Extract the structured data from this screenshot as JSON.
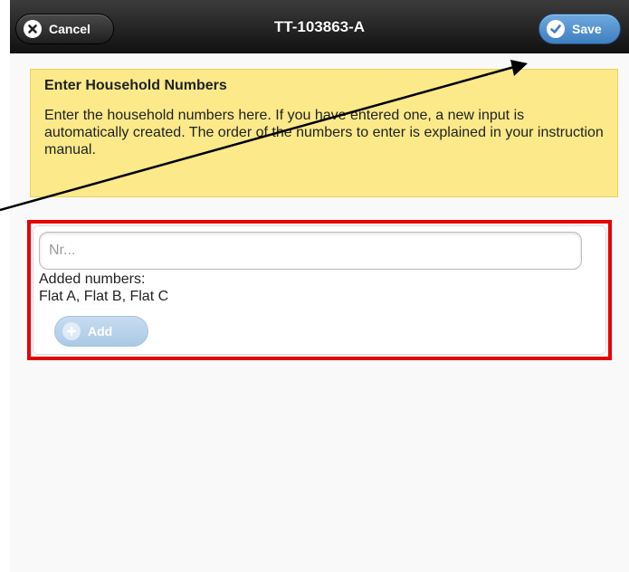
{
  "header": {
    "title": "TT-103863-A",
    "cancel_label": "Cancel",
    "save_label": "Save"
  },
  "notice": {
    "title": "Enter Household Numbers",
    "text": "Enter the household numbers here. If you have entered one, a new input is automatically created. The order of the numbers to enter is explained in your instruction manual."
  },
  "form": {
    "input_placeholder": "Nr...",
    "input_value": "",
    "added_label": "Added numbers:",
    "added_values": "Flat A, Flat B, Flat C",
    "add_label": "Add"
  },
  "icons": {
    "cancel": "close-icon",
    "save": "check-icon",
    "add": "plus-icon"
  },
  "colors": {
    "header": "#1e1e1e",
    "save_button": "#4f8fd0",
    "notice_background": "#fbe98a",
    "highlight_border": "#e60000",
    "add_button_disabled": "#b8d2ea"
  }
}
